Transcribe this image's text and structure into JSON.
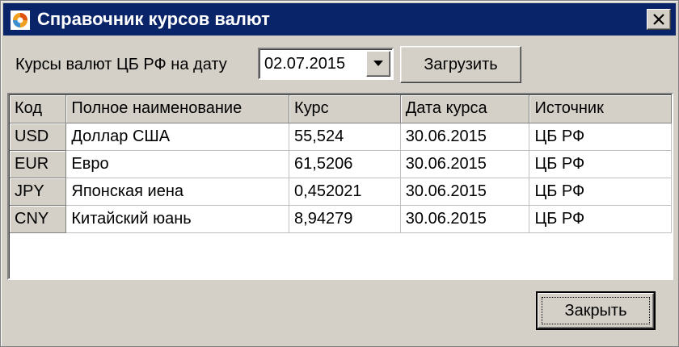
{
  "window": {
    "title": "Справочник курсов валют"
  },
  "toolbar": {
    "date_label": "Курсы валют ЦБ РФ на дату",
    "date_value": "02.07.2015",
    "load_label": "Загрузить"
  },
  "grid": {
    "headers": [
      "Код",
      "Полное наименование",
      "Курс",
      "Дата курса",
      "Источник"
    ],
    "rows": [
      [
        "USD",
        "Доллар США",
        "55,524",
        "30.06.2015",
        "ЦБ РФ"
      ],
      [
        "EUR",
        "Евро",
        "61,5206",
        "30.06.2015",
        "ЦБ РФ"
      ],
      [
        "JPY",
        "Японская иена",
        "0,452021",
        "30.06.2015",
        "ЦБ РФ"
      ],
      [
        "CNY",
        "Китайский юань",
        "8,94279",
        "30.06.2015",
        "ЦБ РФ"
      ]
    ]
  },
  "footer": {
    "close_label": "Закрыть"
  },
  "colors": {
    "titlebar": "#0a246a",
    "face": "#d4d0c8"
  },
  "icons": {
    "app": "app-logo-icon",
    "close": "close-icon",
    "dropdown": "chevron-down-icon"
  }
}
